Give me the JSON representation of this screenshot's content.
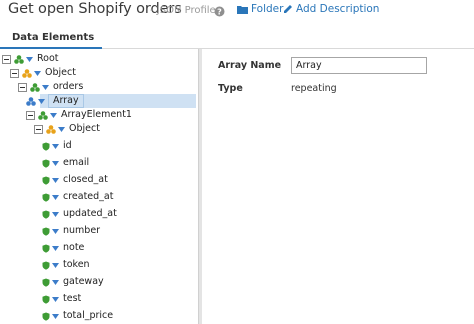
{
  "header": {
    "title": "Get open Shopify orders",
    "subtitle": "- JSON Profile",
    "help_icon": "help-icon",
    "folder_label": "Folder",
    "folder_icon": "folder-icon",
    "add_description_label": "Add Description",
    "add_description_icon": "pencil-icon"
  },
  "tabs": [
    {
      "label": "Data Elements",
      "active": true
    }
  ],
  "tree": {
    "selected": "Array",
    "nodes": [
      {
        "label": "Root",
        "icon": "element-group-icon",
        "expandable": true
      },
      {
        "label": "Object",
        "icon": "object-icon",
        "expandable": true
      },
      {
        "label": "orders",
        "icon": "element-group-icon",
        "expandable": true
      },
      {
        "label": "Array",
        "icon": "array-icon",
        "expandable": false
      },
      {
        "label": "ArrayElement1",
        "icon": "element-group-icon",
        "expandable": true
      },
      {
        "label": "Object",
        "icon": "object-icon",
        "expandable": true
      },
      {
        "label": "id",
        "icon": "field-icon"
      },
      {
        "label": "email",
        "icon": "field-icon"
      },
      {
        "label": "closed_at",
        "icon": "field-icon"
      },
      {
        "label": "created_at",
        "icon": "field-icon"
      },
      {
        "label": "updated_at",
        "icon": "field-icon"
      },
      {
        "label": "number",
        "icon": "field-icon"
      },
      {
        "label": "note",
        "icon": "field-icon"
      },
      {
        "label": "token",
        "icon": "field-icon"
      },
      {
        "label": "gateway",
        "icon": "field-icon"
      },
      {
        "label": "test",
        "icon": "field-icon"
      },
      {
        "label": "total_price",
        "icon": "field-icon"
      }
    ]
  },
  "details": {
    "array_name_label": "Array Name",
    "array_name_value": "Array",
    "type_label": "Type",
    "type_value": "repeating"
  },
  "colors": {
    "accent": "#2a76b9",
    "selection": "#cfe1f3",
    "green": "#3e9c35",
    "orange": "#e8a21a",
    "blue": "#3c7cc9"
  }
}
